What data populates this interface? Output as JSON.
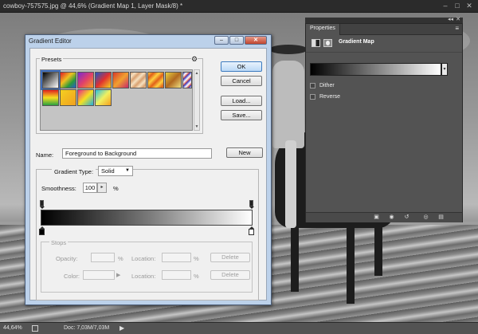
{
  "document": {
    "title": "cowboy-757575.jpg @ 44,6% (Gradient Map 1, Layer Mask/8) *",
    "window_controls": [
      "–",
      "□",
      "✕"
    ]
  },
  "status_bar": {
    "zoom": "44,64%",
    "doc_info": "Doc: 7,03M/7,03M",
    "arrow": "▶"
  },
  "properties": {
    "tab": "Properties",
    "menu": "≡",
    "collapse": "◂◂",
    "close": "✕",
    "layer_name": "Gradient Map",
    "gradient_dropdown": "▾",
    "dither_label": "Dither",
    "reverse_label": "Reverse",
    "dither_checked": false,
    "reverse_checked": false,
    "footer_icons": [
      "clip-to-layer-icon",
      "view-previous-icon",
      "reset-icon",
      "visibility-icon",
      "trash-icon"
    ]
  },
  "dialog": {
    "title": "Gradient Editor",
    "title_buttons": [
      "–",
      "□",
      "✕"
    ],
    "presets_label": "Presets",
    "gear": "⚙",
    "buttons": {
      "ok": "OK",
      "cancel": "Cancel",
      "load": "Load...",
      "save": "Save...",
      "new": "New"
    },
    "name_label": "Name:",
    "name_value": "Foreground to Background",
    "gradient_type_label": "Gradient Type:",
    "gradient_type_value": "Solid",
    "smoothness_label": "Smoothness:",
    "smoothness_value": "100",
    "smoothness_unit": "%",
    "stops": {
      "label": "Stops",
      "opacity_label": "Opacity:",
      "color_label": "Color:",
      "location_label": "Location:",
      "percent": "%",
      "delete_label": "Delete"
    },
    "colors": {
      "dialog_frame": "#bcd1ea",
      "dialog_body": "#f0f0f0",
      "ok_accent": "#3d7bbf"
    }
  }
}
